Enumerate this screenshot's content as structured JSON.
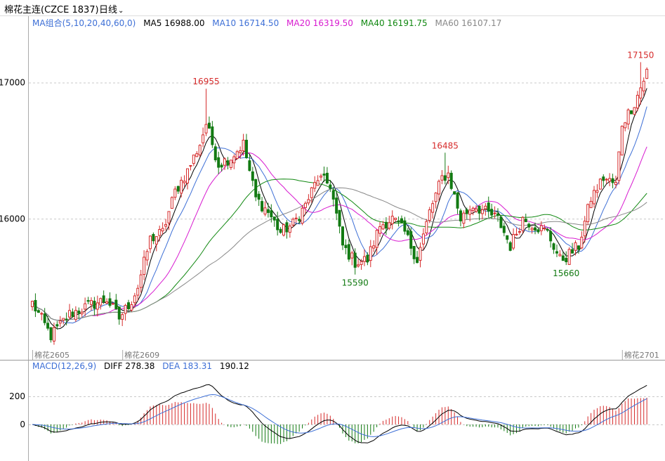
{
  "header": {
    "title": "棉花主连(CZCE 1837)",
    "period": "日线"
  },
  "ma_legend": {
    "group": "MA组合(5,10,20,40,60,0)",
    "items": [
      {
        "label": "MA5 16988.00",
        "color": "#000000"
      },
      {
        "label": "MA10 16714.50",
        "color": "#3d6fd6"
      },
      {
        "label": "MA20 16319.50",
        "color": "#d81bd0"
      },
      {
        "label": "MA40 16191.75",
        "color": "#118811"
      },
      {
        "label": "MA60 16107.17",
        "color": "#888888"
      }
    ]
  },
  "macd_legend": {
    "group": "MACD(12,26,9)",
    "diff": "DIFF 278.38",
    "dea": "DEA 183.31",
    "macd": "190.12"
  },
  "colors": {
    "up": "#d62b2b",
    "down": "#127a12",
    "label_blue": "#3d6fd6"
  },
  "chart_data": [
    {
      "type": "candlestick",
      "title": "棉花主连(CZCE 1837)",
      "period": "日线",
      "y_ticks": [
        16000,
        17000
      ],
      "ylim": [
        15000,
        17400
      ],
      "contract_labels": [
        "棉花2605",
        "棉花2609",
        "棉花2701"
      ],
      "contract_label_index": [
        0,
        29,
        190
      ],
      "annotations": [
        {
          "text": "16955",
          "index": 56,
          "kind": "high"
        },
        {
          "text": "15590",
          "index": 104,
          "kind": "low"
        },
        {
          "text": "16485",
          "index": 133,
          "kind": "high"
        },
        {
          "text": "15660",
          "index": 172,
          "kind": "low"
        },
        {
          "text": "17150",
          "index": 196,
          "kind": "high"
        }
      ],
      "trend_anchors": [
        [
          0,
          15380
        ],
        [
          6,
          15140
        ],
        [
          12,
          15300
        ],
        [
          18,
          15360
        ],
        [
          24,
          15410
        ],
        [
          28,
          15270
        ],
        [
          32,
          15400
        ],
        [
          34,
          15500
        ],
        [
          38,
          15850
        ],
        [
          42,
          15900
        ],
        [
          46,
          16200
        ],
        [
          50,
          16350
        ],
        [
          54,
          16550
        ],
        [
          56,
          16700
        ],
        [
          60,
          16400
        ],
        [
          64,
          16450
        ],
        [
          68,
          16550
        ],
        [
          72,
          16150
        ],
        [
          76,
          16050
        ],
        [
          80,
          15900
        ],
        [
          84,
          15960
        ],
        [
          88,
          16100
        ],
        [
          92,
          16300
        ],
        [
          96,
          16250
        ],
        [
          100,
          15800
        ],
        [
          104,
          15680
        ],
        [
          108,
          15700
        ],
        [
          112,
          15950
        ],
        [
          116,
          16000
        ],
        [
          120,
          15900
        ],
        [
          124,
          15700
        ],
        [
          128,
          16050
        ],
        [
          132,
          16300
        ],
        [
          134,
          16330
        ],
        [
          138,
          16000
        ],
        [
          142,
          16100
        ],
        [
          146,
          16050
        ],
        [
          150,
          16000
        ],
        [
          154,
          15800
        ],
        [
          158,
          16000
        ],
        [
          162,
          15950
        ],
        [
          166,
          15900
        ],
        [
          170,
          15700
        ],
        [
          172,
          15720
        ],
        [
          176,
          15800
        ],
        [
          180,
          16150
        ],
        [
          184,
          16300
        ],
        [
          188,
          16250
        ],
        [
          190,
          16700
        ],
        [
          194,
          16850
        ],
        [
          198,
          17080
        ]
      ],
      "last_index": 198
    },
    {
      "type": "macd",
      "title": "MACD(12,26,9)",
      "y_ticks": [
        0,
        200
      ],
      "ylim": [
        -260,
        380
      ],
      "diff_last": 278.38,
      "dea_last": 183.31,
      "macd_last": 190.12
    }
  ]
}
